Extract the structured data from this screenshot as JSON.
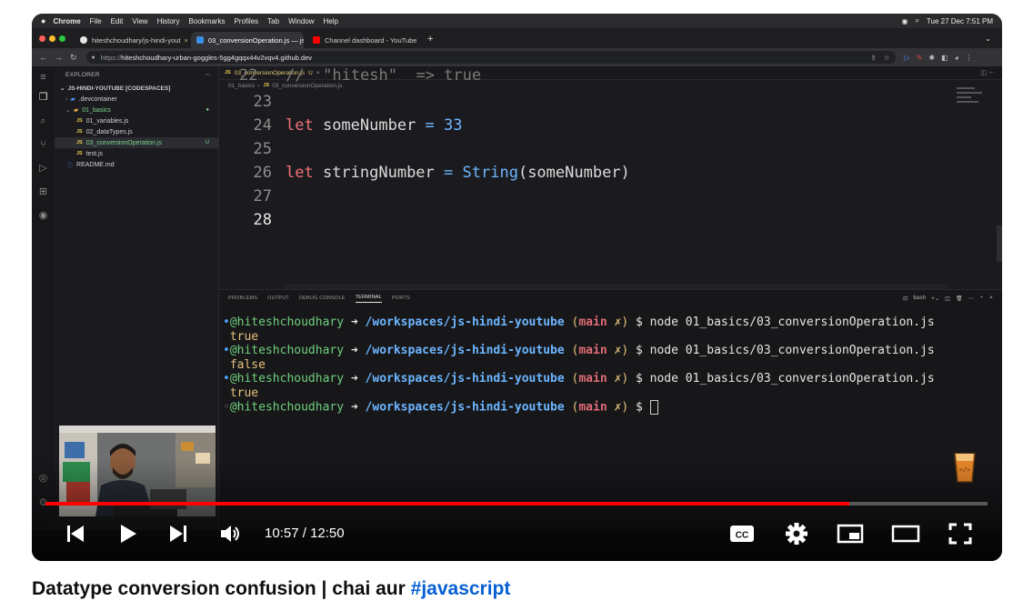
{
  "menubar": {
    "app": "Chrome",
    "items": [
      "File",
      "Edit",
      "View",
      "History",
      "Bookmarks",
      "Profiles",
      "Tab",
      "Window",
      "Help"
    ],
    "clock": "Tue 27 Dec  7:51 PM"
  },
  "browser": {
    "tabs": [
      {
        "label": "hiteshchoudhary/js-hindi-yout",
        "close": "×"
      },
      {
        "label": "03_conversionOperation.js — js",
        "close": "×"
      },
      {
        "label": "Channel dashboard - YouTube",
        "close": "×"
      }
    ],
    "new_tab": "+",
    "url_prefix": "https://",
    "url_host": "hiteshchoudhary-urban-goggles-5gg4gqqx44v2vqv4.github.dev"
  },
  "explorer": {
    "title": "EXPLORER",
    "root": "JS-HINDI-YOUTUBE [CODESPACES]",
    "items": [
      {
        "label": ".devcontainer"
      },
      {
        "label": "01_basics"
      },
      {
        "label": "01_variables.js"
      },
      {
        "label": "02_dataTypes.js"
      },
      {
        "label": "03_conversionOperation.js",
        "mark": "U"
      },
      {
        "label": "test.js"
      },
      {
        "label": "README.md"
      }
    ]
  },
  "editor": {
    "tab_label": "03_conversionOperation.js",
    "tab_mark": "U",
    "breadcrumb_folder": "01_basics",
    "breadcrumb_file": "03_conversionOperation.js",
    "partial_line": "22   //  \"hitesh\"  => true",
    "lines": [
      {
        "n": "23",
        "kw": "",
        "text": "",
        "num": ""
      },
      {
        "n": "24",
        "kw": "let",
        "text": " someNumber ",
        "num": "33"
      },
      {
        "n": "25",
        "kw": "",
        "text": "",
        "num": ""
      },
      {
        "n": "26",
        "kw": "let",
        "text": " stringNumber ",
        "num": ""
      },
      {
        "n": "27",
        "kw": "",
        "text": "",
        "num": ""
      },
      {
        "n": "28",
        "kw": "",
        "text": "",
        "num": ""
      }
    ],
    "line26_fn": "String",
    "line26_arg": "someNumber"
  },
  "panel": {
    "tabs": [
      "PROBLEMS",
      "OUTPUT",
      "DEBUG CONSOLE",
      "TERMINAL",
      "PORTS"
    ],
    "active_tab": "TERMINAL",
    "shell": "bash"
  },
  "terminal": {
    "user": "@hiteshchoudhary",
    "arrow": "➜",
    "path": "/workspaces/js-hindi-youtube",
    "branch": "main",
    "dirty": "✗",
    "command": "node 01_basics/03_conversionOperation.js",
    "outputs": [
      "true",
      "false",
      "true"
    ]
  },
  "player": {
    "current_time": "10:57",
    "duration": "12:50",
    "progress": 0.8532,
    "accent": "#ff0000"
  },
  "video": {
    "title_text": "Datatype conversion confusion | chai aur ",
    "hashtag": "#javascript"
  }
}
